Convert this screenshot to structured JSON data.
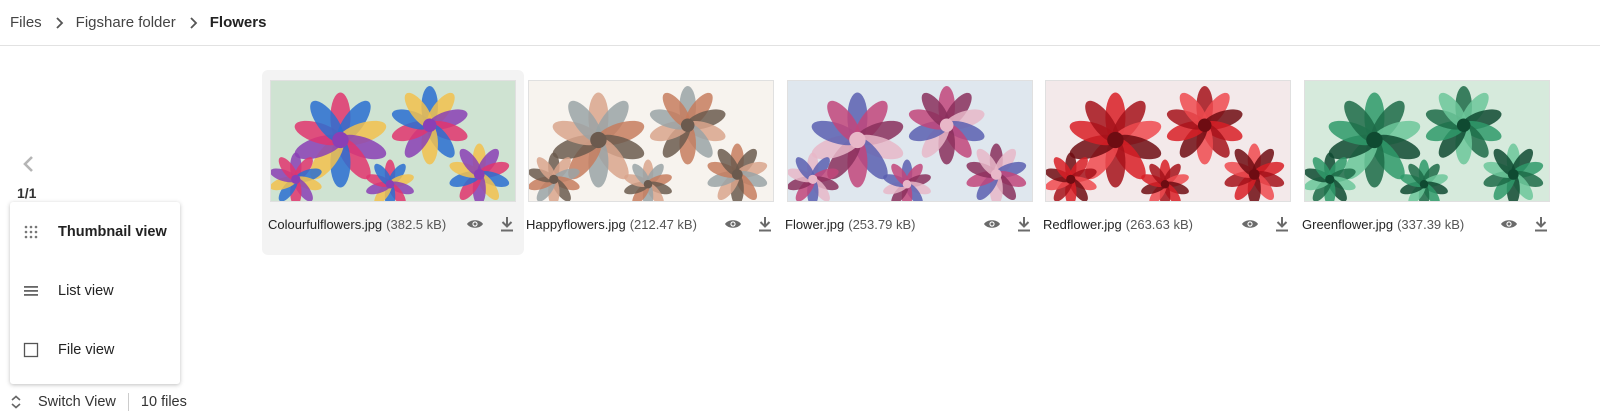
{
  "breadcrumb": {
    "items": [
      "Files",
      "Figshare folder"
    ],
    "current": "Flowers"
  },
  "pagination": {
    "label": "1/1"
  },
  "view_menu": {
    "items": [
      {
        "label": "Thumbnail view",
        "icon": "grid-dots-icon",
        "active": true
      },
      {
        "label": "List view",
        "icon": "list-icon",
        "active": false
      },
      {
        "label": "File view",
        "icon": "square-icon",
        "active": false
      }
    ]
  },
  "footer": {
    "switch_label": "Switch View",
    "count_label": "10 files"
  },
  "files": [
    {
      "name": "Colourfulflowers.jpg",
      "size": "(382.5 kB)",
      "selected": true,
      "palette": [
        "#cfe3d2",
        "#e0356f",
        "#2a6fd1",
        "#f2c14e",
        "#8a3fb5"
      ]
    },
    {
      "name": "Happyflowers.jpg",
      "size": "(212.47 kB)",
      "selected": false,
      "palette": [
        "#f7f3ee",
        "#d9a58c",
        "#9aa3a6",
        "#c77c5e",
        "#6b5a4e"
      ]
    },
    {
      "name": "Flower.jpg",
      "size": "(253.79 kB)",
      "selected": false,
      "palette": [
        "#dfe7ee",
        "#5a5fb0",
        "#c2457a",
        "#8a2f5c",
        "#e8b7c8"
      ]
    },
    {
      "name": "Redflower.jpg",
      "size": "(263.63 kB)",
      "selected": false,
      "palette": [
        "#f3e9ea",
        "#d81f26",
        "#a5121a",
        "#ef4a4f",
        "#6e0c12"
      ]
    },
    {
      "name": "Greenflower.jpg",
      "size": "(337.39 kB)",
      "selected": false,
      "palette": [
        "#d6eadc",
        "#2f9a6a",
        "#1d6b48",
        "#6cc79a",
        "#0f4a31"
      ]
    }
  ],
  "colors": {
    "icon_gray": "#6b6b6b",
    "selected_bg": "#f3f3f3"
  }
}
